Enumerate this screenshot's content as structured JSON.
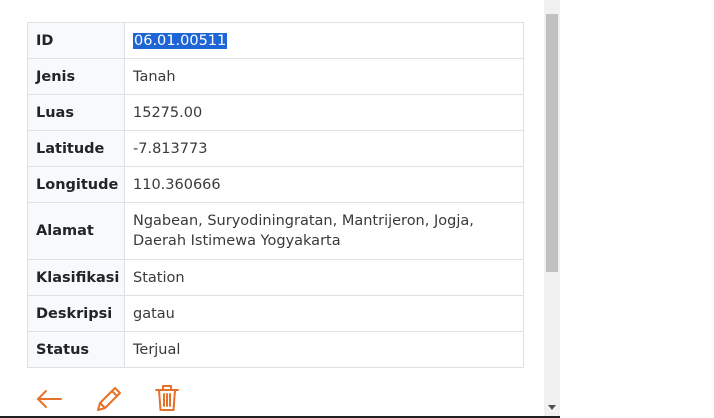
{
  "rows": [
    {
      "label": "ID",
      "value": "06.01.00511"
    },
    {
      "label": "Jenis",
      "value": "Tanah"
    },
    {
      "label": "Luas",
      "value": "15275.00"
    },
    {
      "label": "Latitude",
      "value": "-7.813773"
    },
    {
      "label": "Longitude",
      "value": "110.360666"
    },
    {
      "label": "Alamat",
      "value": "Ngabean, Suryodiningratan, Mantrijeron, Jogja, Daerah Istimewa Yogyakarta"
    },
    {
      "label": "Klasifikasi",
      "value": "Station"
    },
    {
      "label": "Deskripsi",
      "value": "gatau"
    },
    {
      "label": "Status",
      "value": "Terjual"
    }
  ],
  "actions": {
    "back_icon": "arrow-left-icon",
    "edit_icon": "pencil-icon",
    "delete_icon": "trash-icon"
  },
  "colors": {
    "accent": "#e8712a",
    "selection": "#1e65d6",
    "border": "#dee2e6"
  }
}
